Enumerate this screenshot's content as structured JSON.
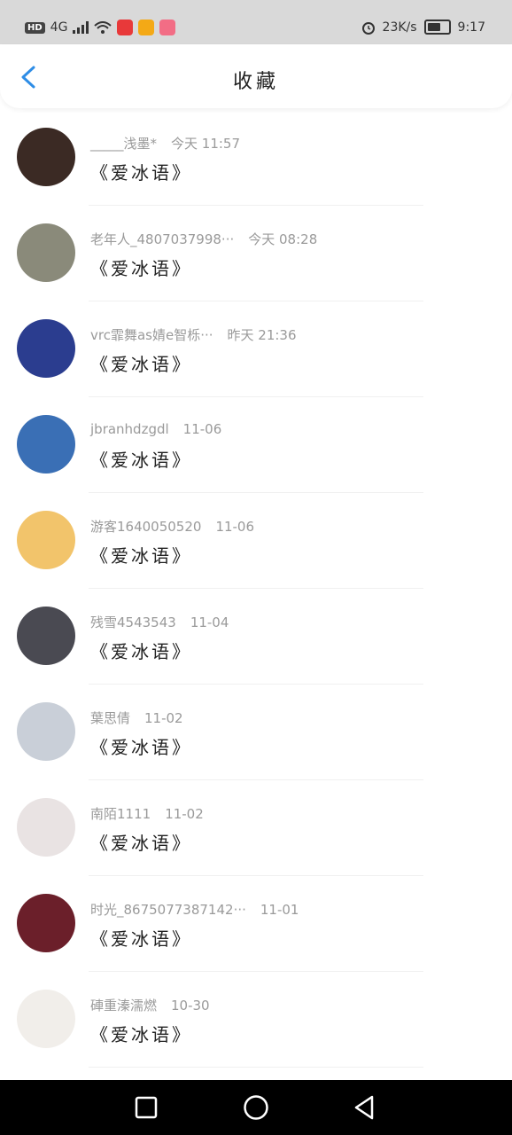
{
  "status_bar": {
    "hd": "HD",
    "network": "4G",
    "speed": "23K/s",
    "time": "9:17",
    "app_icon_colors": [
      "#e8393a",
      "#f4a916",
      "#f26d85"
    ]
  },
  "header": {
    "title": "收藏"
  },
  "items": [
    {
      "username": "_____浅墨*",
      "time": "今天 11:57",
      "title": "《爱冰语》",
      "avatar_color": "#3b2a24"
    },
    {
      "username": "老年人_4807037998···",
      "time": "今天 08:28",
      "title": "《爱冰语》",
      "avatar_color": "#8a8a7a"
    },
    {
      "username": "vrc霏舞as婧e智栎···",
      "time": "昨天 21:36",
      "title": "《爱冰语》",
      "avatar_color": "#2b3d8f"
    },
    {
      "username": "jbranhdzgdl",
      "time": "11-06",
      "title": "《爱冰语》",
      "avatar_color": "#3a6fb5"
    },
    {
      "username": "游客1640050520",
      "time": "11-06",
      "title": "《爱冰语》",
      "avatar_color": "#f2c46b"
    },
    {
      "username": "残雪4543543",
      "time": "11-04",
      "title": "《爱冰语》",
      "avatar_color": "#4a4a52"
    },
    {
      "username": "葉思倩",
      "time": "11-02",
      "title": "《爱冰语》",
      "avatar_color": "#c9cfd8"
    },
    {
      "username": "南陌1111",
      "time": "11-02",
      "title": "《爱冰语》",
      "avatar_color": "#e9e3e3"
    },
    {
      "username": "时光_8675077387142···",
      "time": "11-01",
      "title": "《爱冰语》",
      "avatar_color": "#6b1f2a"
    },
    {
      "username": "硨重溱濡燃",
      "time": "10-30",
      "title": "《爱冰语》",
      "avatar_color": "#f1eeea"
    }
  ],
  "colors": {
    "accent": "#2e8de6",
    "status_bar_bg": "#d9d9d9",
    "nav_bar_bg": "#000000"
  }
}
